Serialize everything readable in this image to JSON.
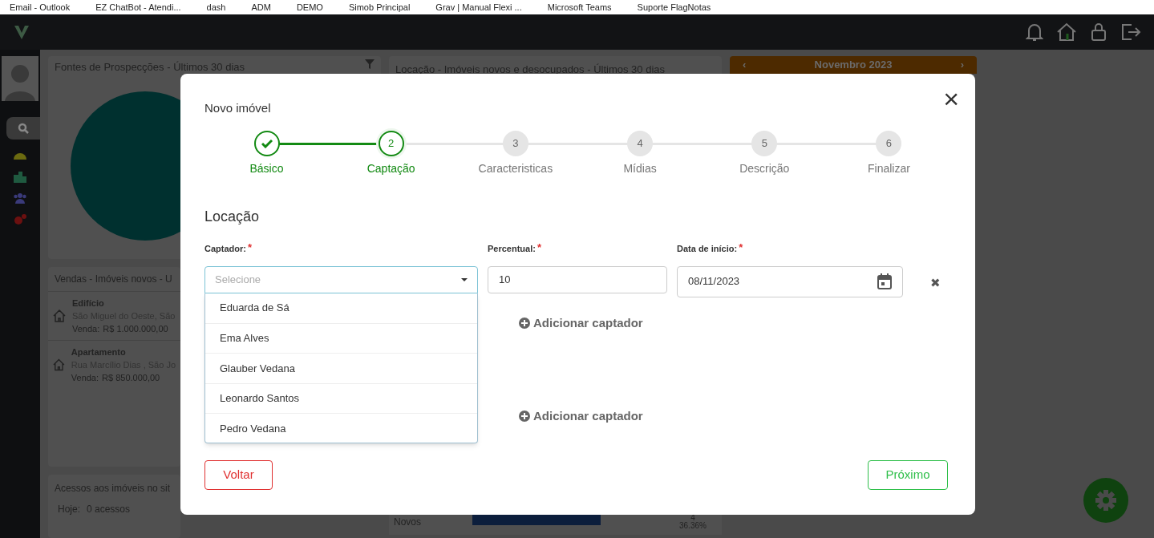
{
  "bookmarks": [
    "Email - Outlook",
    "EZ ChatBot - Atendi...",
    "dash",
    "ADM",
    "DEMO",
    "Simob Principal",
    "Grav | Manual Flexi ...",
    "Microsoft Teams",
    "Suporte FlagNotas"
  ],
  "dashboard": {
    "prospect_panel": {
      "title": "Fontes de Prospecções - Últimos 30 dias"
    },
    "rental_panel": {
      "title": "Locação - Imóveis novos e desocupados - Últimos 30 dias",
      "row_label": "Novos",
      "count": "4",
      "percent": "36.36%",
      "level": 0.64
    },
    "calendar": {
      "month": "Novembro 2023",
      "prev": "‹",
      "next": "›"
    },
    "sales_panel": {
      "title": "Vendas - Imóveis novos - U",
      "items": [
        {
          "type": "Edifício",
          "address": "São Miguel do Oeste, São",
          "price_label": "Venda:",
          "price": "R$  1.000.000,00"
        },
        {
          "type": "Apartamento",
          "address": "Rua Marcílio Dias , São Jo",
          "price_label": "Venda:",
          "price": "R$  850.000,00"
        }
      ]
    },
    "access_panel": {
      "title": "Acessos aos imóveis no sit",
      "today_label": "Hoje:",
      "today_value": "0 acessos"
    }
  },
  "modal": {
    "title": "Novo imóvel",
    "close": "×",
    "steps": [
      {
        "label": "Básico",
        "completed": true,
        "selected": false
      },
      {
        "number": "2",
        "label": "Captação",
        "completed": false,
        "selected": true
      },
      {
        "number": "3",
        "label": "Caracteristicas",
        "completed": false,
        "selected": false
      },
      {
        "number": "4",
        "label": "Mídias",
        "completed": false,
        "selected": false
      },
      {
        "number": "5",
        "label": "Descrição",
        "completed": false,
        "selected": false
      },
      {
        "number": "6",
        "label": "Finalizar",
        "completed": false,
        "selected": false
      }
    ],
    "section_title": "Locação",
    "fields": [
      {
        "kind": "select",
        "label": "Captador:",
        "required_mark": "*",
        "placeholder": "Selecione",
        "expanded": true,
        "options": [
          "Eduarda de Sá",
          "Ema Alves",
          "Glauber Vedana",
          "Leonardo Santos",
          "Pedro Vedana"
        ]
      },
      {
        "kind": "text",
        "label": "Percentual:",
        "required_mark": "*",
        "value": "10"
      },
      {
        "kind": "date",
        "label": "Data de início:",
        "required_mark": "*",
        "value": "08/11/2023"
      }
    ],
    "remove": "✖",
    "add_buttons": [
      "Adicionar captador",
      "Adicionar captador"
    ],
    "back_button": "Voltar",
    "next_button": "Próximo"
  }
}
